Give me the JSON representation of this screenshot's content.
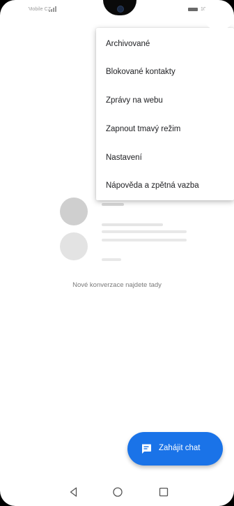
{
  "status_bar": {
    "carrier": "T-Mobile CZ",
    "time": "10:00",
    "icons": [
      "signal-icon",
      "battery-icon"
    ]
  },
  "overflow_menu": {
    "items": [
      {
        "label": "Archivované"
      },
      {
        "label": "Blokované kontakty"
      },
      {
        "label": "Zprávy na webu"
      },
      {
        "label": "Zapnout tmavý režim"
      },
      {
        "label": "Nastavení"
      },
      {
        "label": "Nápověda a zpětná vazba"
      }
    ]
  },
  "empty_state": {
    "message": "Nové konverzace najdete tady"
  },
  "fab": {
    "label": "Zahájit chat",
    "icon": "chat-icon",
    "color": "#1a73e8"
  },
  "nav_bar": {
    "icons": [
      "back-icon",
      "home-icon",
      "recents-icon"
    ]
  }
}
